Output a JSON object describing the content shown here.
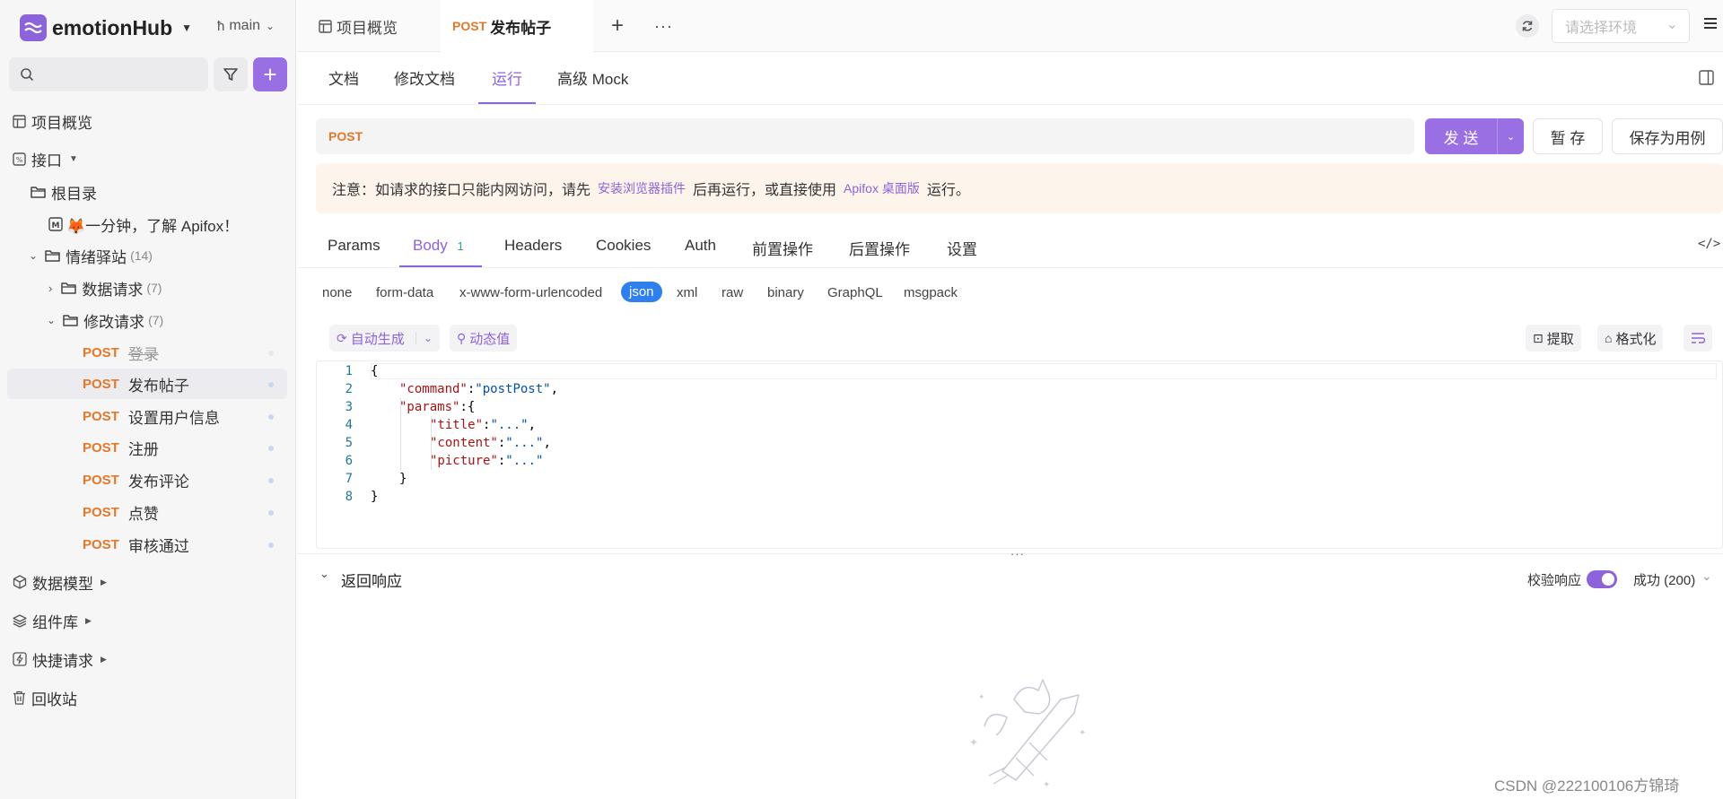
{
  "workspace": {
    "name": "emotionHub",
    "branch": "main"
  },
  "sidebar": {
    "search_placeholder": "",
    "items": {
      "overview": "项目概览",
      "interfaces": "接口",
      "root": "根目录",
      "intro": "🦊一分钟，了解 Apifox！",
      "folder_main": {
        "label": "情绪驿站",
        "count": "(14)"
      },
      "folder_data": {
        "label": "数据请求",
        "count": "(7)"
      },
      "folder_modify": {
        "label": "修改请求",
        "count": "(7)"
      },
      "data_models": "数据模型",
      "components": "组件库",
      "quick_request": "快捷请求",
      "recycle": "回收站"
    },
    "endpoints": [
      {
        "method": "POST",
        "label": "登录"
      },
      {
        "method": "POST",
        "label": "发布帖子"
      },
      {
        "method": "POST",
        "label": "设置用户信息"
      },
      {
        "method": "POST",
        "label": "注册"
      },
      {
        "method": "POST",
        "label": "发布评论"
      },
      {
        "method": "POST",
        "label": "点赞"
      },
      {
        "method": "POST",
        "label": "审核通过"
      }
    ]
  },
  "tabs": {
    "overview": "项目概览",
    "active_method": "POST",
    "active_label": "发布帖子",
    "env_placeholder": "请选择环境"
  },
  "subtabs": [
    "文档",
    "修改文档",
    "运行",
    "高级 Mock"
  ],
  "request": {
    "method": "POST",
    "send": "发 送",
    "save_temp": "暂 存",
    "save_case": "保存为用例"
  },
  "notice": {
    "prefix": "注意：如请求的接口只能内网访问，请先",
    "link1": "安装浏览器插件",
    "middle": "后再运行，或直接使用",
    "link2": "Apifox 桌面版",
    "suffix": "运行。"
  },
  "param_tabs": {
    "params": "Params",
    "body": "Body",
    "body_count": "1",
    "headers": "Headers",
    "cookies": "Cookies",
    "auth": "Auth",
    "pre": "前置操作",
    "post": "后置操作",
    "settings": "设置"
  },
  "body_types": [
    "none",
    "form-data",
    "x-www-form-urlencoded",
    "json",
    "xml",
    "raw",
    "binary",
    "GraphQL",
    "msgpack"
  ],
  "body_tools": {
    "auto": "自动生成",
    "dynamic": "动态值",
    "extract": "提取",
    "format": "格式化"
  },
  "code": {
    "line_numbers": [
      "1",
      "2",
      "3",
      "4",
      "5",
      "6",
      "7",
      "8"
    ],
    "open": "{",
    "command_key": "\"command\"",
    "command_val": "\"postPost\"",
    "params_key": "\"params\"",
    "title_key": "\"title\"",
    "content_key": "\"content\"",
    "picture_key": "\"picture\"",
    "ellipsis_val": "\"...\"",
    "inner_close": "}",
    "close": "}"
  },
  "response": {
    "title": "返回响应",
    "validate": "校验响应",
    "status": "成功 (200)"
  },
  "watermark": "CSDN @222100106方锦琦",
  "colors": {
    "accent": "#8d63d9",
    "method_post": "#e4772a",
    "notice_bg": "#fdf4ec",
    "json_badge": "#2f80ed"
  }
}
